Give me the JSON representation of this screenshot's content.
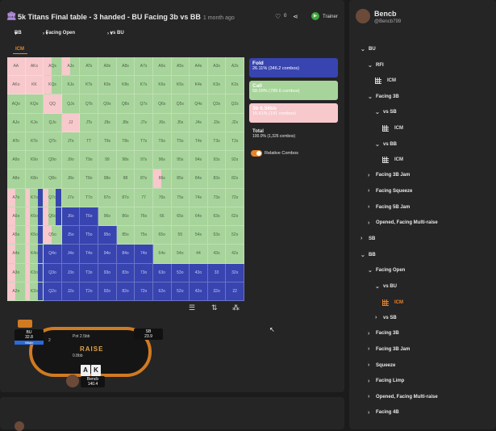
{
  "header": {
    "title": "5k Titans Final table - 3 handed - BU Facing 3b vs BB",
    "ago": "1 month ago",
    "likes": "0",
    "trainer_label": "Trainer"
  },
  "filters": {
    "pos": "BB",
    "situation": "Facing Open",
    "vs": "vs BU"
  },
  "icm_tab": "ICM",
  "legend": {
    "fold": {
      "name": "Fold",
      "detail": "26.11% (346.2 combos)"
    },
    "call": {
      "name": "Call",
      "detail": "58.09% (789.6 combos)"
    },
    "raise": {
      "name": "3b 6.56bb",
      "detail": "15.61% (191 combos)"
    },
    "total_label": "Total",
    "total_detail": "100.0% (1,326 combos)",
    "relative_label": "Relative Combos"
  },
  "hands": [
    [
      "AA",
      "AKs",
      "AQs",
      "AJs",
      "ATs",
      "A9s",
      "A8s",
      "A7s",
      "A6s",
      "A5s",
      "A4s",
      "A3s",
      "A2s"
    ],
    [
      "AKo",
      "KK",
      "KQs",
      "KJs",
      "KTs",
      "K9s",
      "K8s",
      "K7s",
      "K6s",
      "K5s",
      "K4s",
      "K3s",
      "K2s"
    ],
    [
      "AQo",
      "KQo",
      "QQ",
      "QJs",
      "QTs",
      "Q9s",
      "Q8s",
      "Q7s",
      "Q6s",
      "Q5s",
      "Q4s",
      "Q3s",
      "Q2s"
    ],
    [
      "AJo",
      "KJo",
      "QJo",
      "JJ",
      "JTs",
      "J9s",
      "J8s",
      "J7s",
      "J6s",
      "J5s",
      "J4s",
      "J3s",
      "J2s"
    ],
    [
      "ATo",
      "KTo",
      "QTo",
      "JTo",
      "TT",
      "T9s",
      "T8s",
      "T7s",
      "T6s",
      "T5s",
      "T4s",
      "T3s",
      "T2s"
    ],
    [
      "A9o",
      "K9o",
      "Q9o",
      "J9o",
      "T9o",
      "99",
      "98s",
      "97s",
      "96s",
      "95s",
      "94s",
      "93s",
      "92s"
    ],
    [
      "A8o",
      "K8o",
      "Q8o",
      "J8o",
      "T8o",
      "98o",
      "88",
      "87s",
      "86s",
      "85s",
      "84s",
      "83s",
      "82s"
    ],
    [
      "A7o",
      "K7o",
      "Q7o",
      "J7o",
      "T7o",
      "97o",
      "87o",
      "77",
      "76s",
      "75s",
      "74s",
      "73s",
      "72s"
    ],
    [
      "A6o",
      "K6o",
      "Q6o",
      "J6o",
      "T6o",
      "96o",
      "86o",
      "76o",
      "66",
      "65s",
      "64s",
      "63s",
      "62s"
    ],
    [
      "A5o",
      "K5o",
      "Q5o",
      "J5o",
      "T5o",
      "95o",
      "85o",
      "75o",
      "65o",
      "55",
      "54s",
      "53s",
      "52s"
    ],
    [
      "A4o",
      "K4o",
      "Q4o",
      "J4o",
      "T4o",
      "94o",
      "84o",
      "74o",
      "64o",
      "54o",
      "44",
      "43s",
      "42s"
    ],
    [
      "A3o",
      "K3o",
      "Q3o",
      "J3o",
      "T3o",
      "93o",
      "83o",
      "73o",
      "63o",
      "53o",
      "43o",
      "33",
      "32s"
    ],
    [
      "A2o",
      "K2o",
      "Q2o",
      "J2o",
      "T2o",
      "92o",
      "82o",
      "72o",
      "62o",
      "52o",
      "42o",
      "32o",
      "22"
    ]
  ],
  "actions": [
    [
      "R",
      "R",
      "m1",
      "m1",
      "c",
      "c",
      "c",
      "c",
      "c",
      "c",
      "c",
      "c",
      "c"
    ],
    [
      "R",
      "R",
      "m1",
      "c",
      "c",
      "c",
      "c",
      "c",
      "c",
      "c",
      "c",
      "c",
      "c"
    ],
    [
      "c",
      "c",
      "R",
      "c",
      "c",
      "c",
      "c",
      "c",
      "c",
      "c",
      "c",
      "c",
      "c"
    ],
    [
      "c",
      "c",
      "c",
      "R",
      "c",
      "c",
      "c",
      "c",
      "c",
      "c",
      "c",
      "c",
      "c"
    ],
    [
      "c",
      "c",
      "c",
      "c",
      "c",
      "c",
      "c",
      "c",
      "c",
      "c",
      "c",
      "c",
      "c"
    ],
    [
      "c",
      "c",
      "c",
      "c",
      "c",
      "c",
      "c",
      "c",
      "c",
      "c",
      "c",
      "c",
      "c"
    ],
    [
      "c",
      "c",
      "c",
      "c",
      "c",
      "c",
      "c",
      "c",
      "m1",
      "c",
      "c",
      "c",
      "c"
    ],
    [
      "m1",
      "m2",
      "m2",
      "c",
      "c",
      "c",
      "c",
      "c",
      "c",
      "c",
      "c",
      "c",
      "c"
    ],
    [
      "m1",
      "m2",
      "m2",
      "F",
      "F",
      "c",
      "c",
      "c",
      "c",
      "c",
      "c",
      "c",
      "c"
    ],
    [
      "m1",
      "m2",
      "m1",
      "F",
      "F",
      "F",
      "c",
      "c",
      "c",
      "c",
      "c",
      "c",
      "c"
    ],
    [
      "m1",
      "m2",
      "F",
      "F",
      "F",
      "F",
      "F",
      "F",
      "c",
      "c",
      "c",
      "c",
      "c"
    ],
    [
      "m1",
      "m2",
      "F",
      "F",
      "F",
      "F",
      "F",
      "F",
      "F",
      "F",
      "F",
      "F",
      "F"
    ],
    [
      "m1",
      "m2",
      "F",
      "F",
      "F",
      "F",
      "F",
      "F",
      "F",
      "F",
      "F",
      "F",
      "F"
    ]
  ],
  "poker_table": {
    "pot": "Pot 2.5bb",
    "hero_cards": [
      "A",
      "K"
    ],
    "seat_left": {
      "pos": "BU",
      "stack": "32.8",
      "tag": "Villain"
    },
    "seat_right": {
      "pos": "SB",
      "stack": "23.9"
    },
    "seat_bottom": {
      "name": "Bencb",
      "stack": "140.4"
    },
    "bet_left": "2",
    "bet_mid": "0.8bb",
    "logo": "RAISE"
  },
  "user": {
    "name": "Bencb",
    "handle": "@Bencb799"
  },
  "tree": [
    {
      "label": "BU",
      "chev": "down"
    },
    {
      "label": "RFI",
      "chev": "down"
    },
    {
      "label": "ICM",
      "icm": true
    },
    {
      "label": "Facing 3B",
      "chev": "down"
    },
    {
      "label": "vs SB",
      "chev": "down"
    },
    {
      "label": "ICM",
      "icm": true
    },
    {
      "label": "vs BB",
      "chev": "down"
    },
    {
      "label": "ICM",
      "icm": true
    },
    {
      "label": "Facing 3B Jam",
      "chev": "right"
    },
    {
      "label": "Facing Squeeze",
      "chev": "right"
    },
    {
      "label": "Facing 5B Jam",
      "chev": "right"
    },
    {
      "label": "Opened, Facing Multi-raise",
      "chev": "right"
    },
    {
      "label": "SB",
      "chev": "right"
    },
    {
      "label": "BB",
      "chev": "down"
    },
    {
      "label": "Facing Open",
      "chev": "down"
    },
    {
      "label": "vs BU",
      "chev": "down"
    },
    {
      "label": "ICM",
      "icm": true,
      "active": true
    },
    {
      "label": "vs SB",
      "chev": "right"
    },
    {
      "label": "Facing 3B",
      "chev": "right"
    },
    {
      "label": "Facing 3B Jam",
      "chev": "right"
    },
    {
      "label": "Squeeze",
      "chev": "right"
    },
    {
      "label": "Facing Limp",
      "chev": "right"
    },
    {
      "label": "Opened, Facing Multi-raise",
      "chev": "right"
    },
    {
      "label": "Facing 4B",
      "chev": "right"
    }
  ],
  "colors": {
    "fold": "#3844b0",
    "call": "#a7d49a",
    "raise": "#f7c8cc",
    "accent": "#e8832a"
  }
}
